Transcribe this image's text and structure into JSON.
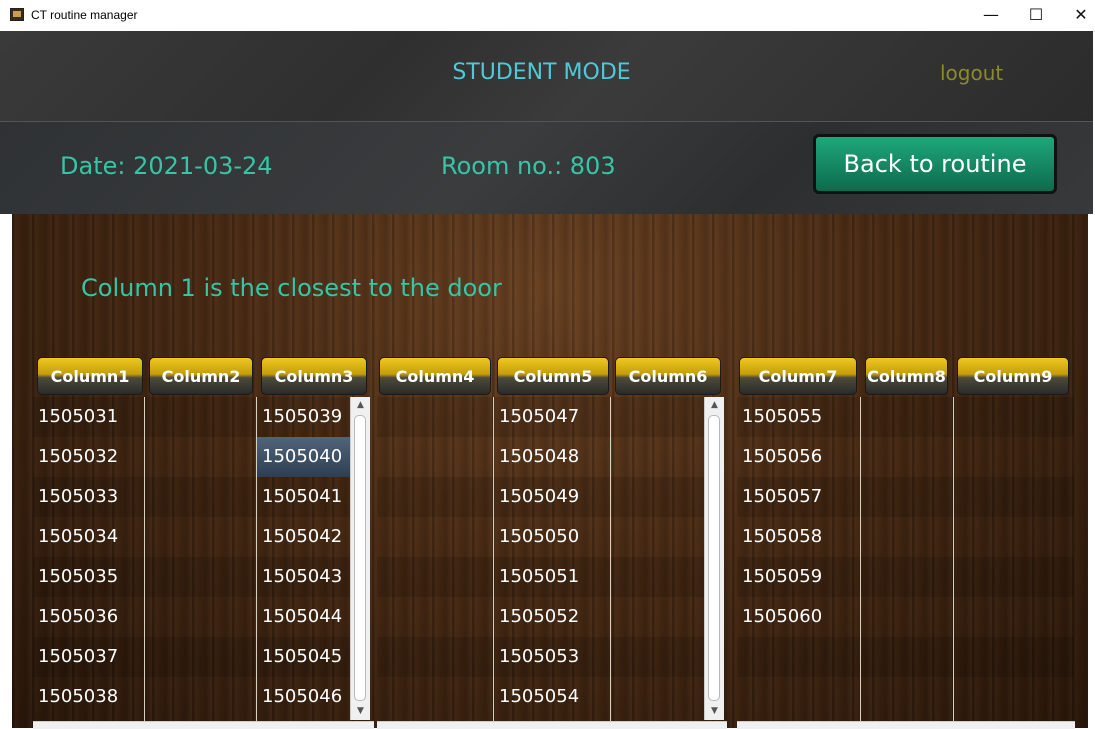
{
  "window": {
    "title": "CT routine manager",
    "controls": {
      "minimize": "—",
      "maximize": "☐",
      "close": "✕"
    }
  },
  "header": {
    "mode_title": "STUDENT MODE",
    "logout_label": "logout"
  },
  "info": {
    "date": "Date: 2021-03-24",
    "room": "Room no.: 803",
    "back_button": "Back to routine"
  },
  "hint": "Column 1 is the closest to the door",
  "colors": {
    "accent_teal": "#36c5a6",
    "title_cyan": "#4ec9d8",
    "logout_olive": "#8d8a2c",
    "button_green": "#1fa77a",
    "header_gold": "#f0c820"
  },
  "tables": [
    {
      "columns": [
        {
          "header": "Column1",
          "cells": [
            "1505031",
            "1505032",
            "1505033",
            "1505034",
            "1505035",
            "1505036",
            "1505037",
            "1505038"
          ]
        },
        {
          "header": "Column2",
          "cells": [
            "",
            "",
            "",
            "",
            "",
            "",
            "",
            ""
          ]
        },
        {
          "header": "Column3",
          "cells": [
            "1505039",
            "1505040",
            "1505041",
            "1505042",
            "1505043",
            "1505044",
            "1505045",
            "1505046"
          ]
        }
      ],
      "selected": {
        "column": 2,
        "row": 1
      }
    },
    {
      "columns": [
        {
          "header": "Column4",
          "cells": [
            "",
            "",
            "",
            "",
            "",
            "",
            "",
            ""
          ]
        },
        {
          "header": "Column5",
          "cells": [
            "1505047",
            "1505048",
            "1505049",
            "1505050",
            "1505051",
            "1505052",
            "1505053",
            "1505054"
          ]
        },
        {
          "header": "Column6",
          "cells": [
            "",
            "",
            "",
            "",
            "",
            "",
            "",
            ""
          ]
        }
      ]
    },
    {
      "columns": [
        {
          "header": "Column7",
          "cells": [
            "1505055",
            "1505056",
            "1505057",
            "1505058",
            "1505059",
            "1505060",
            "",
            ""
          ]
        },
        {
          "header": "Column8",
          "cells": [
            "",
            "",
            "",
            "",
            "",
            "",
            "",
            ""
          ]
        },
        {
          "header": "Column9",
          "cells": [
            "",
            "",
            "",
            "",
            "",
            "",
            "",
            ""
          ]
        }
      ]
    }
  ]
}
